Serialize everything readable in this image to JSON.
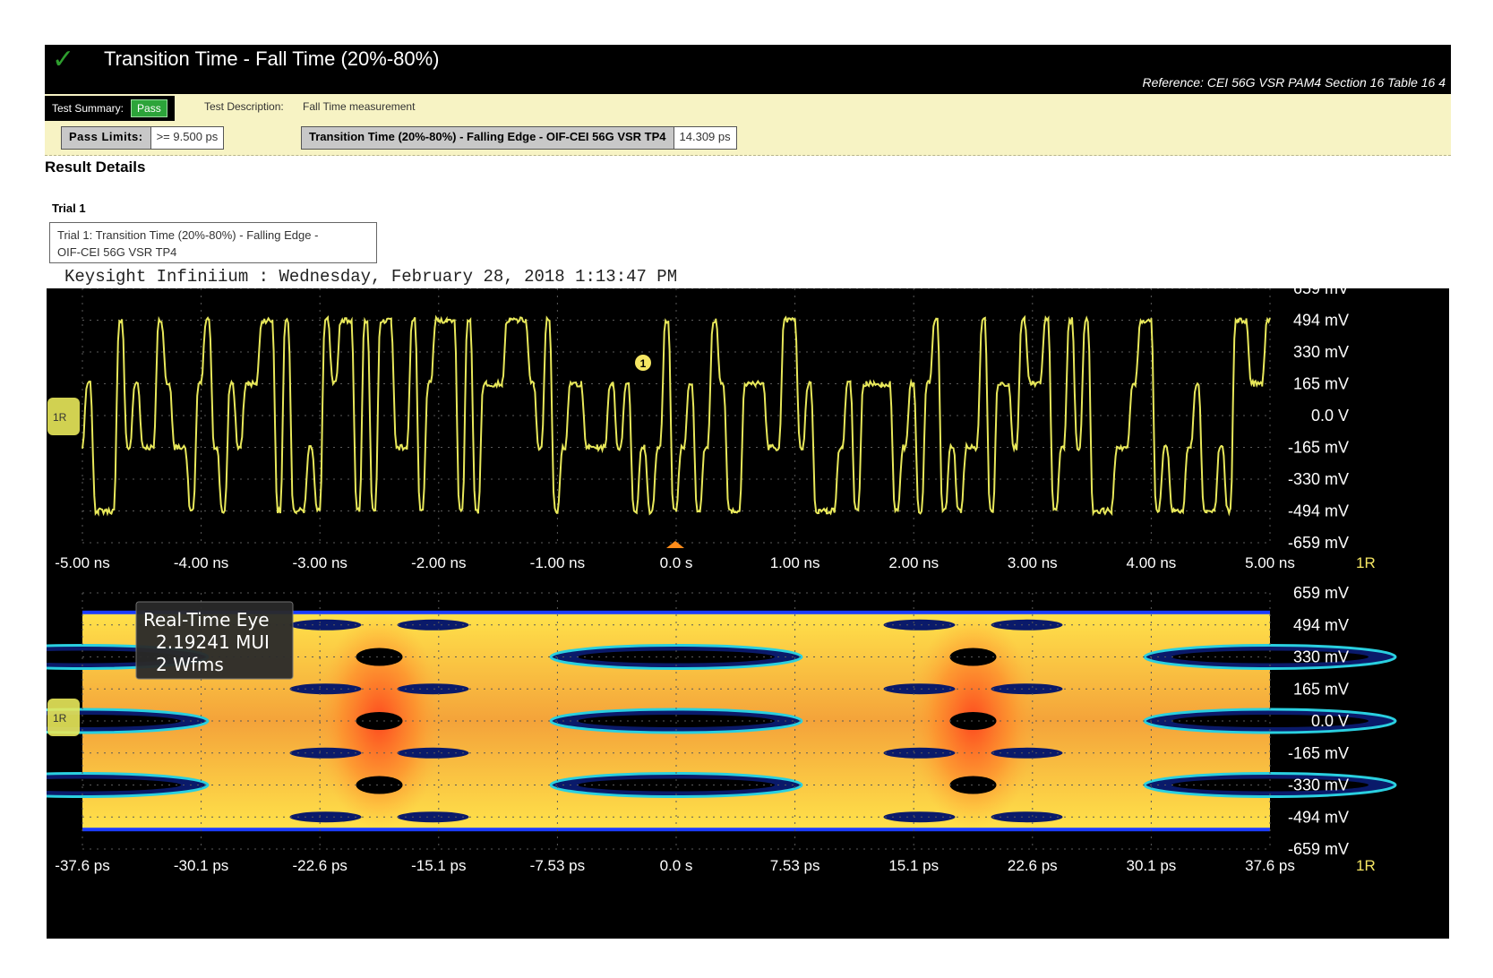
{
  "header": {
    "title": "Transition Time - Fall Time (20%-80%)",
    "reference": "Reference: CEI 56G VSR PAM4 Section 16 Table 16 4"
  },
  "summary": {
    "test_summary_label": "Test Summary:",
    "status": "Pass",
    "test_description_label": "Test Description:",
    "test_description": "Fall Time measurement",
    "pass_limits_label": "Pass Limits:",
    "pass_limits_value": ">= 9.500 ps",
    "measurement_label": "Transition Time (20%-80%) - Falling Edge - OIF-CEI 56G VSR TP4",
    "measurement_value": "14.309 ps"
  },
  "details": {
    "result_heading": "Result Details",
    "trial_heading": "Trial 1",
    "trial_caption_line1": "Trial 1: Transition Time (20%-80%) - Falling Edge -",
    "trial_caption_line2": "OIF-CEI 56G VSR TP4",
    "scope_header": "Keysight Infiniium : Wednesday, February 28, 2018 1:13:47 PM"
  },
  "scope": {
    "colors": {
      "waveform": "#e8e85a",
      "grid": "#555555",
      "label": "#ffffff",
      "trigger": "#ff8c1a",
      "marker": "#f5e663"
    },
    "channel_label": "1R",
    "marker_label": "1",
    "y_labels": [
      "659 mV",
      "494 mV",
      "330 mV",
      "165 mV",
      "0.0 V",
      "-165 mV",
      "-330 mV",
      "-494 mV",
      "-659 mV"
    ],
    "top_x_labels": [
      "-5.00 ns",
      "-4.00 ns",
      "-3.00 ns",
      "-2.00 ns",
      "-1.00 ns",
      "0.0 s",
      "1.00 ns",
      "2.00 ns",
      "3.00 ns",
      "4.00 ns",
      "5.00 ns"
    ],
    "bottom_x_labels": [
      "-37.6 ps",
      "-30.1 ps",
      "-22.6 ps",
      "-15.1 ps",
      "-7.53 ps",
      "0.0 s",
      "7.53 ps",
      "15.1 ps",
      "22.6 ps",
      "30.1 ps",
      "37.6 ps"
    ],
    "eye_box": {
      "line1": "Real-Time Eye",
      "line2": "2.19241 MUI",
      "line3": "2 Wfms"
    },
    "time_axis_ns": [
      -5,
      5
    ],
    "voltage_axis_mv": [
      -659,
      659
    ],
    "pam4_levels_mv": [
      -494,
      -165,
      165,
      494
    ]
  }
}
